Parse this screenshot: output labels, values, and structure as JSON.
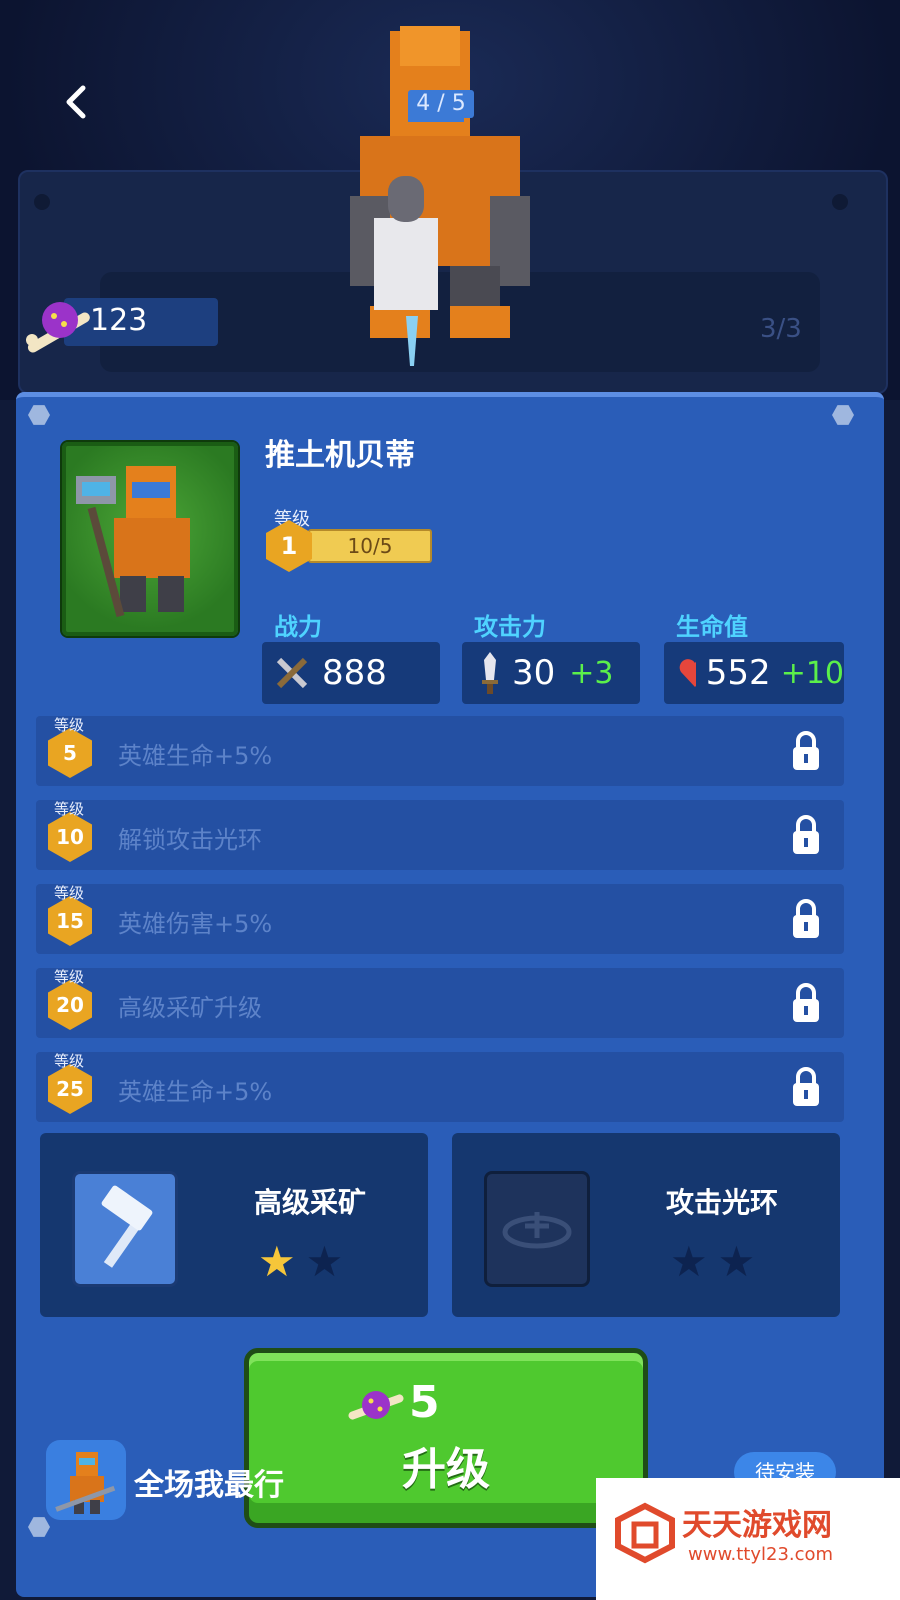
{
  "header": {
    "page_indicator": "4 / 5",
    "currency_amount": "123",
    "background_counter": "3/3"
  },
  "hero": {
    "name": "推土机贝蒂",
    "level_label": "等级",
    "level": "1",
    "level_progress_text": "10/5",
    "level_progress_fraction": 1.0
  },
  "stats": [
    {
      "label": "战力",
      "value": "888",
      "bonus": "",
      "icon": "power-icon"
    },
    {
      "label": "攻击力",
      "value": "30",
      "bonus": "+3",
      "icon": "sword-icon"
    },
    {
      "label": "生命值",
      "value": "552",
      "bonus": "+10",
      "icon": "heart-icon"
    }
  ],
  "unlocks": [
    {
      "tag": "等级",
      "level": "5",
      "text": "英雄生命+5%"
    },
    {
      "tag": "等级",
      "level": "10",
      "text": "解锁攻击光环"
    },
    {
      "tag": "等级",
      "level": "15",
      "text": "英雄伤害+5%"
    },
    {
      "tag": "等级",
      "level": "20",
      "text": "高级采矿升级"
    },
    {
      "tag": "等级",
      "level": "25",
      "text": "英雄生命+5%"
    }
  ],
  "skills": [
    {
      "name": "高级采矿",
      "stars_filled": 1,
      "stars_total": 2,
      "icon": "hammer-icon"
    },
    {
      "name": "攻击光环",
      "stars_filled": 0,
      "stars_total": 2,
      "icon": "aura-icon"
    }
  ],
  "upgrade": {
    "cost": "5",
    "label": "升级"
  },
  "ad": {
    "text": "全场我最行",
    "install_label": "待安装"
  },
  "watermark": {
    "title": "天天游戏网",
    "url": "www.ttyl23.com"
  },
  "colors": {
    "panel": "#2a5db8",
    "stat_label": "#4fd3ff",
    "bonus": "#5bf04a",
    "level_badge": "#e9a522",
    "upgrade_button": "#4fc92f"
  }
}
